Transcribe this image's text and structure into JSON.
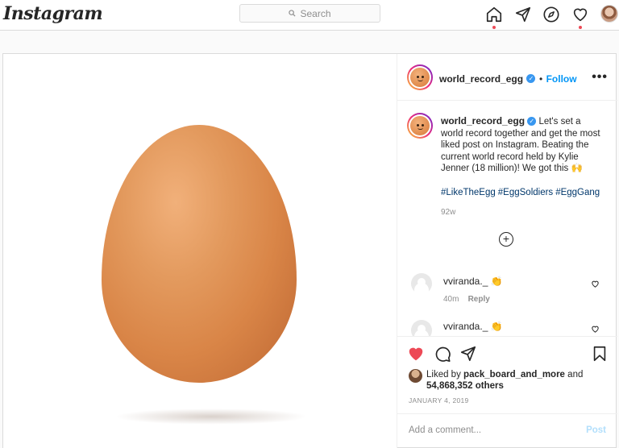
{
  "app": {
    "logo": "Instagram"
  },
  "search": {
    "placeholder": "Search"
  },
  "nav": {
    "icons": [
      "home-icon",
      "direct-icon",
      "explore-icon",
      "activity-heart-icon",
      "profile-avatar"
    ]
  },
  "post": {
    "username": "world_record_egg",
    "follow_separator": "•",
    "follow_label": "Follow",
    "more_label": "•••",
    "caption": {
      "username": "world_record_egg",
      "text": "Let's set a world record together and get the most liked post on Instagram. Beating the current world record held by Kylie Jenner (18 million)! We got this 🙌",
      "hashtags": [
        "#LikeTheEgg",
        "#EggSoldiers",
        "#EggGang"
      ],
      "age": "92w"
    },
    "comments": [
      {
        "username": "vviranda._",
        "emoji": "👏",
        "age": "40m",
        "reply_label": "Reply"
      },
      {
        "username": "vviranda._",
        "emoji": "👏"
      }
    ],
    "liked_by_prefix": "Liked by",
    "liked_by_user": "pack_board_and_more",
    "liked_by_and": "and",
    "liked_by_count": "54,868,352 others",
    "date": "JANUARY 4, 2019",
    "add_comment_placeholder": "Add a comment...",
    "post_button": "Post"
  },
  "colors": {
    "accent": "#0095f6",
    "like": "#ed4956",
    "hashtag": "#00376b",
    "muted": "#8e8e8e"
  }
}
